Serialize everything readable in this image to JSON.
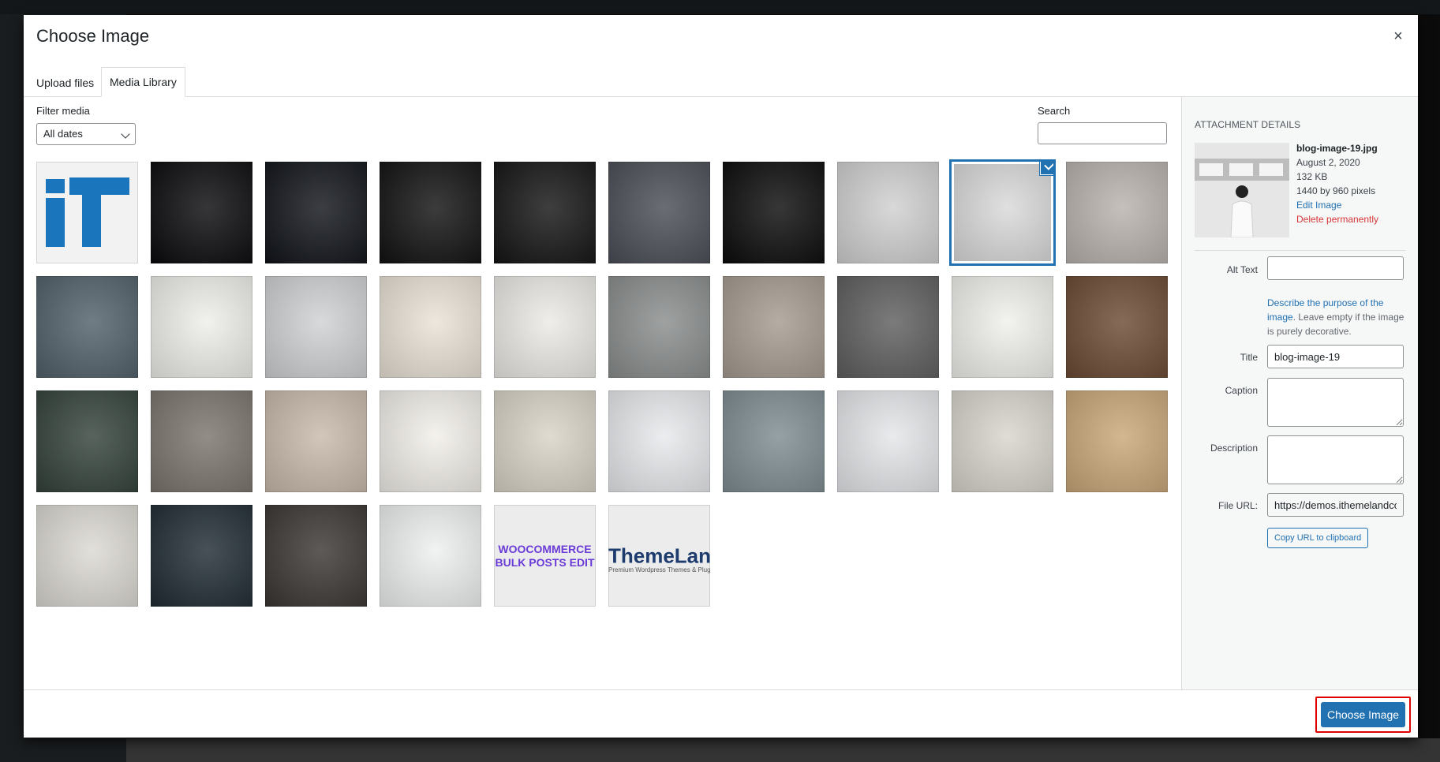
{
  "modal": {
    "title": "Choose Image",
    "close_glyph": "×"
  },
  "tabs": [
    {
      "label": "Upload files",
      "active": false
    },
    {
      "label": "Media Library",
      "active": true
    }
  ],
  "filter": {
    "label": "Filter media",
    "date_value": "All dates"
  },
  "search": {
    "label": "Search",
    "value": ""
  },
  "media": [
    {
      "id": "logo-it",
      "type": "logo",
      "bg": "#f2f2f2"
    },
    {
      "id": "dark-apple",
      "bg": "#0a0a0d"
    },
    {
      "id": "phone-dark",
      "bg": "#101319"
    },
    {
      "id": "headphones",
      "bg": "#111111"
    },
    {
      "id": "phone-white",
      "bg": "#141414"
    },
    {
      "id": "smartwatch",
      "bg": "#4a4d56"
    },
    {
      "id": "speaker",
      "bg": "#0b0b0b"
    },
    {
      "id": "woman-necklace",
      "bg": "#cfd0cf"
    },
    {
      "id": "woman-train",
      "bg": "#d9d9d9",
      "selected": true
    },
    {
      "id": "winter-girl",
      "bg": "#b8b2ad"
    },
    {
      "id": "dogs-van",
      "bg": "#51606a"
    },
    {
      "id": "cake-blueberries",
      "bg": "#eeeeea"
    },
    {
      "id": "snow-mountain",
      "bg": "#cfd1d2"
    },
    {
      "id": "flowers-bouquet",
      "bg": "#e9e2d6"
    },
    {
      "id": "popcorn",
      "bg": "#eceae6"
    },
    {
      "id": "foggy-mountains",
      "bg": "#8a8d8d"
    },
    {
      "id": "couple-wedding",
      "bg": "#a59a90"
    },
    {
      "id": "hood-mask",
      "bg": "#5e5e5e"
    },
    {
      "id": "plant-leaf",
      "bg": "#f0f0ec"
    },
    {
      "id": "wood-table",
      "bg": "#6b4a33"
    },
    {
      "id": "forest-hat",
      "bg": "#33413a"
    },
    {
      "id": "street-couple",
      "bg": "#7a746d"
    },
    {
      "id": "flower-crown-couple",
      "bg": "#c8b9ab"
    },
    {
      "id": "curly-girl",
      "bg": "#f2efea"
    },
    {
      "id": "beach-bride",
      "bg": "#d9d3c6"
    },
    {
      "id": "laptop-top",
      "bg": "#e7e9ec"
    },
    {
      "id": "lake-boat",
      "bg": "#7e8c91"
    },
    {
      "id": "laptop-top-2",
      "bg": "#e4e6e9"
    },
    {
      "id": "avocado-food",
      "bg": "#d8d5cd"
    },
    {
      "id": "noodles",
      "bg": "#c9a779"
    },
    {
      "id": "knife-pepper",
      "bg": "#dcd9d2"
    },
    {
      "id": "cookies-flowers",
      "bg": "#1f2b33"
    },
    {
      "id": "sushi-soup",
      "bg": "#3a3632"
    },
    {
      "id": "salad-flowers",
      "bg": "#eef0ef"
    },
    {
      "id": "woo-banner",
      "type": "woo",
      "bg": "#ececec",
      "text1": "WOOCOMMERCE",
      "text2": "BULK POSTS EDIT"
    },
    {
      "id": "themeland",
      "type": "themeland",
      "bg": "#ececec",
      "text1": "ThemeLand",
      "text2": "Premium Wordpress Themes & Plugins"
    }
  ],
  "details": {
    "heading": "ATTACHMENT DETAILS",
    "filename": "blog-image-19.jpg",
    "date": "August 2, 2020",
    "size": "132 KB",
    "dimensions": "1440 by 960 pixels",
    "edit_link": "Edit Image",
    "delete_link": "Delete permanently",
    "alt_label": "Alt Text",
    "alt_value": "",
    "alt_help_link": "Describe the purpose of the image",
    "alt_help_rest": ". Leave empty if the image is purely decorative.",
    "title_label": "Title",
    "title_value": "blog-image-19",
    "caption_label": "Caption",
    "caption_value": "",
    "description_label": "Description",
    "description_value": "",
    "fileurl_label": "File URL:",
    "fileurl_value": "https://demos.ithemelandco.com",
    "copy_button": "Copy URL to clipboard"
  },
  "toolbar": {
    "choose_button": "Choose Image"
  },
  "colors": {
    "accent": "#2271b1",
    "danger": "#d63638",
    "highlight": "#e00000"
  }
}
